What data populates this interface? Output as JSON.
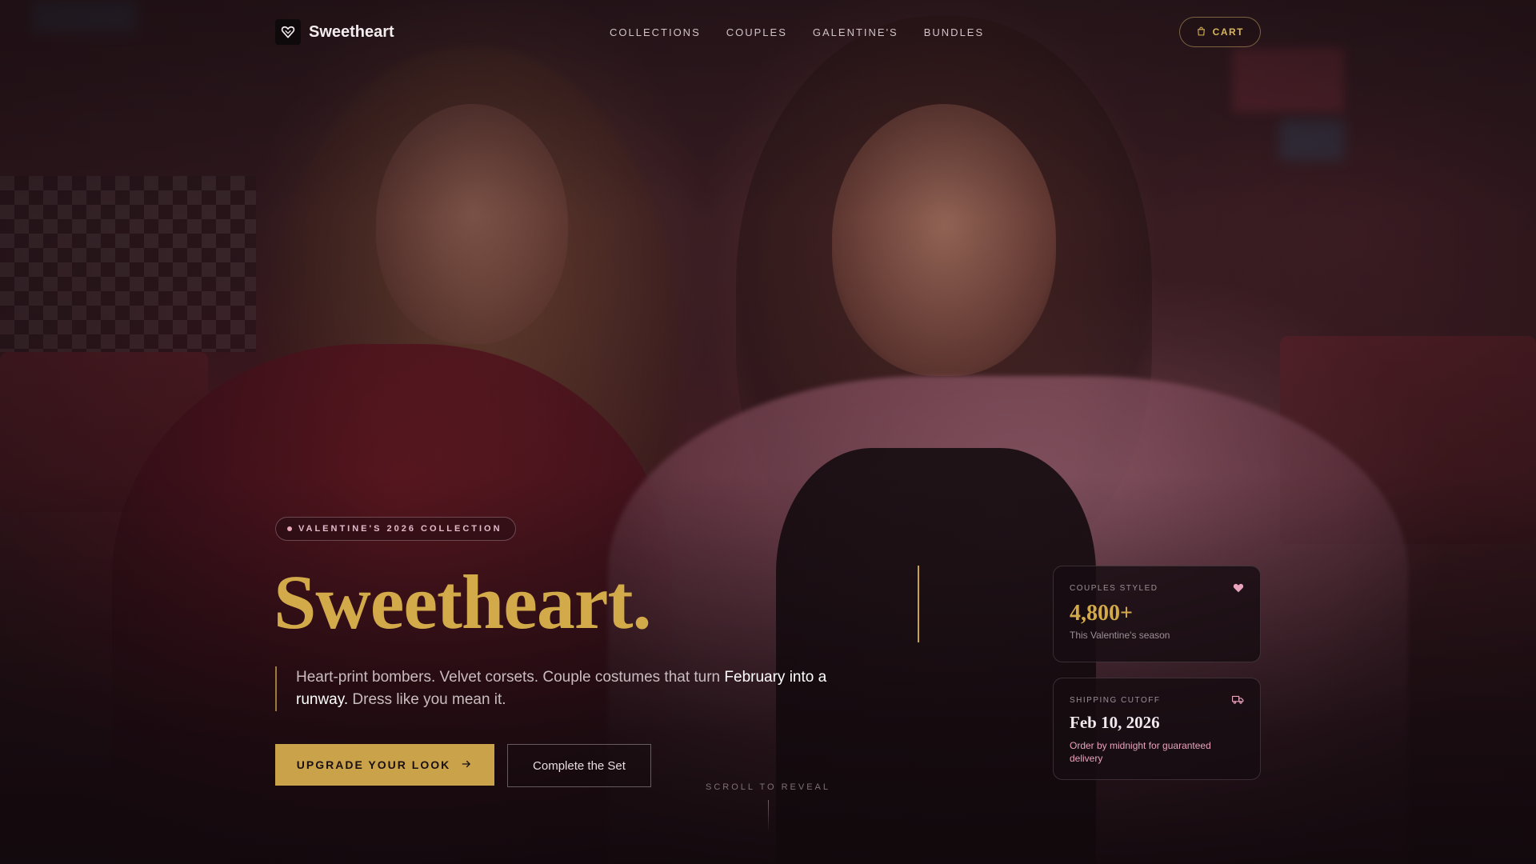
{
  "brand": {
    "name": "Sweetheart",
    "logo_icon": "heart-gem-icon"
  },
  "nav": {
    "items": [
      {
        "label": "COLLECTIONS"
      },
      {
        "label": "COUPLES"
      },
      {
        "label": "GALENTINE'S"
      },
      {
        "label": "BUNDLES"
      }
    ]
  },
  "cart": {
    "label": "CART",
    "icon": "shopping-bag-icon"
  },
  "hero": {
    "badge": "VALENTINE'S 2026 COLLECTION",
    "title": "Sweetheart.",
    "desc_part1": "Heart-print bombers. Velvet corsets. Couple costumes that turn ",
    "desc_emphasis": "February into a runway.",
    "desc_part2": " Dress like you mean it.",
    "primary_cta": "UPGRADE YOUR LOOK",
    "secondary_cta": "Complete the Set",
    "scroll_label": "SCROLL TO REVEAL"
  },
  "stats": {
    "couples": {
      "label": "COUPLES STYLED",
      "value": "4,800+",
      "note": "This Valentine's season",
      "icon": "heart-icon"
    },
    "shipping": {
      "label": "SHIPPING CUTOFF",
      "value": "Feb 10, 2026",
      "note": "Order by midnight for guaranteed delivery",
      "icon": "truck-icon"
    }
  },
  "colors": {
    "gold": "#c9a24a",
    "pink": "#e9a3bd",
    "dark": "#160c11"
  }
}
